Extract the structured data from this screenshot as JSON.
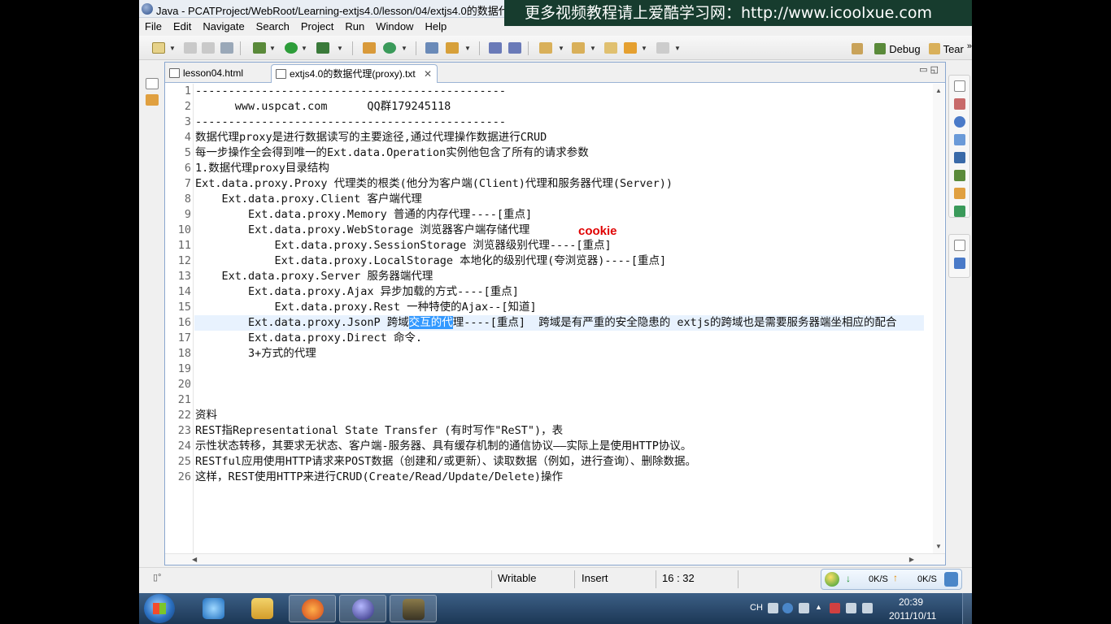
{
  "window": {
    "title": "Java - PCATProject/WebRoot/Learning-extjs4.0/lesson/04/extjs4.0的数据代",
    "banner": "更多视频教程请上爱酷学习网：http://www.icoolxue.com"
  },
  "menu": [
    "File",
    "Edit",
    "Navigate",
    "Search",
    "Project",
    "Run",
    "Window",
    "Help"
  ],
  "perspectives": {
    "debug": "Debug",
    "team": "Tear",
    "more": "»"
  },
  "tabs": [
    {
      "label": "lesson04.html",
      "icon": "html-file-icon"
    },
    {
      "label": "extjs4.0的数据代理(proxy).txt",
      "icon": "text-file-icon",
      "close": "✕"
    }
  ],
  "tab_controls": "▭  ◱",
  "editor": {
    "lines": [
      {
        "n": "1",
        "text": "-----------------------------------------------"
      },
      {
        "n": "2",
        "text": "      www.uspcat.com      QQ群179245118"
      },
      {
        "n": "3",
        "text": "-----------------------------------------------"
      },
      {
        "n": "4",
        "text": "数据代理proxy是进行数据读写的主要途径,通过代理操作数据进行CRUD"
      },
      {
        "n": "5",
        "text": "每一步操作全会得到唯一的Ext.data.Operation实例他包含了所有的请求参数"
      },
      {
        "n": "6",
        "text": "1.数据代理proxy目录结构"
      },
      {
        "n": "7",
        "text": "Ext.data.proxy.Proxy 代理类的根类(他分为客户端(Client)代理和服务器代理(Server))"
      },
      {
        "n": "8",
        "text": "    Ext.data.proxy.Client 客户端代理"
      },
      {
        "n": "9",
        "text": "        Ext.data.proxy.Memory 普通的内存代理----[重点]"
      },
      {
        "n": "10",
        "text": "        Ext.data.proxy.WebStorage 浏览器客户端存储代理"
      },
      {
        "n": "11",
        "text": "            Ext.data.proxy.SessionStorage 浏览器级别代理----[重点]"
      },
      {
        "n": "12",
        "text": "            Ext.data.proxy.LocalStorage 本地化的级别代理(夸浏览器)----[重点]"
      },
      {
        "n": "13",
        "text": "    Ext.data.proxy.Server 服务器端代理"
      },
      {
        "n": "14",
        "text": "        Ext.data.proxy.Ajax 异步加载的方式----[重点]"
      },
      {
        "n": "15",
        "text": "            Ext.data.proxy.Rest 一种特使的Ajax--[知道]"
      },
      {
        "n": "16",
        "text": "        Ext.data.proxy.JsonP 跨域"
      },
      {
        "n": "17",
        "text": "        Ext.data.proxy.Direct 命令."
      },
      {
        "n": "18",
        "text": "        3+方式的代理"
      },
      {
        "n": "19",
        "text": ""
      },
      {
        "n": "20",
        "text": ""
      },
      {
        "n": "21",
        "text": ""
      },
      {
        "n": "22",
        "text": "资料"
      },
      {
        "n": "23",
        "text": "REST指Representational State Transfer (有时写作\"ReST\")，表"
      },
      {
        "n": "24",
        "text": "示性状态转移，其要求无状态、客户端-服务器、具有缓存机制的通信协议——实际上是使用HTTP协议。"
      },
      {
        "n": "25",
        "text": "RESTful应用使用HTTP请求来POST数据（创建和/或更新）、读取数据（例如，进行查询）、删除数据。"
      },
      {
        "n": "26",
        "text": "这样，REST使用HTTP来进行CRUD(Create/Read/Update/Delete)操作"
      }
    ],
    "line16_selected": "交互的代",
    "line16_rest": "理----[重点]  跨域是有严重的安全隐患的 extjs的跨域也是需要服务器端坐相应的配合",
    "annotation": "cookie",
    "annotation_color": "#e00000"
  },
  "status": {
    "writable": "Writable",
    "insert": "Insert",
    "position": "16 : 32",
    "net_down": "0K/S",
    "net_up": "0K/S"
  },
  "taskbar": {
    "apps": [
      "ie-icon",
      "explorer-icon",
      "firefox-icon",
      "eclipse-icon",
      "recorder-icon"
    ],
    "lang": "CH",
    "time": "20:39",
    "date": "2011/10/11"
  },
  "colors": {
    "selection": "#3399ff",
    "current_line": "#e8f2fe",
    "banner_bg": "#173c2e"
  }
}
